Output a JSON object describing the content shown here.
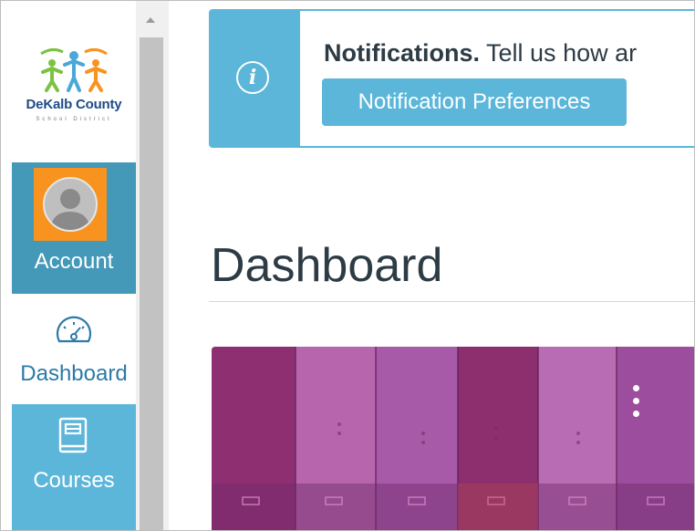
{
  "logo": {
    "name": "DeKalb County",
    "subtitle": "School District"
  },
  "nav": {
    "items": [
      {
        "label": "Account",
        "icon": "avatar-icon",
        "state": "active"
      },
      {
        "label": "Dashboard",
        "icon": "dashboard-gauge-icon",
        "state": "selected"
      },
      {
        "label": "Courses",
        "icon": "courses-book-icon",
        "state": "normal"
      }
    ]
  },
  "banner": {
    "title": "Notifications.",
    "message": "Tell us how ar",
    "button_label": "Notification Preferences",
    "icon": "info-icon"
  },
  "main": {
    "title": "Dashboard"
  },
  "course_card": {
    "menu_icon": "more-vertical-icon"
  },
  "colors": {
    "nav_bg": "#5bb6d9",
    "nav_active_bg": "#4498b8",
    "avatar_highlight": "#f7931e",
    "banner_accent": "#5bb6d9",
    "text_dark": "#2d3b45",
    "card_purple": "#8d3b8e"
  }
}
